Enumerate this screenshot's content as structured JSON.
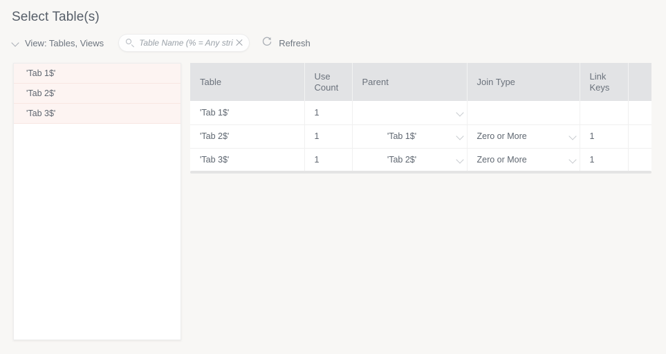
{
  "page": {
    "title": "Select Table(s)",
    "background_color": "#f8f7f5"
  },
  "toolbar": {
    "view_selector": {
      "label": "View: Tables, Views",
      "icon": "chevron-down-icon"
    },
    "search": {
      "placeholder": "Table Name (% = Any string)",
      "value": "",
      "search_icon": "search-icon",
      "clear_icon": "close-icon"
    },
    "refresh": {
      "label": "Refresh",
      "icon": "refresh-icon"
    }
  },
  "table_list": {
    "items": [
      {
        "label": "'Tab 1$'"
      },
      {
        "label": "'Tab 2$'"
      },
      {
        "label": "'Tab 3$'"
      }
    ],
    "highlight_color": "#fdf4f2"
  },
  "grid": {
    "columns": [
      {
        "key": "table",
        "label": "Table"
      },
      {
        "key": "use_count",
        "label": "Use Count"
      },
      {
        "key": "parent",
        "label": "Parent"
      },
      {
        "key": "join_type",
        "label": "Join Type"
      },
      {
        "key": "link_keys",
        "label": "Link Keys"
      },
      {
        "key": "extra",
        "label": ""
      }
    ],
    "rows": [
      {
        "table": "'Tab 1$'",
        "use_count": "1",
        "parent": "",
        "join_type": "",
        "link_keys": "",
        "extra": ""
      },
      {
        "table": "'Tab 2$'",
        "use_count": "1",
        "parent": "'Tab 1$'",
        "join_type": "Zero or More",
        "link_keys": "1",
        "extra": ""
      },
      {
        "table": "'Tab 3$'",
        "use_count": "1",
        "parent": "'Tab 2$'",
        "join_type": "Zero or More",
        "link_keys": "1",
        "extra": ""
      }
    ],
    "link_keys_color": "#f2605a"
  }
}
